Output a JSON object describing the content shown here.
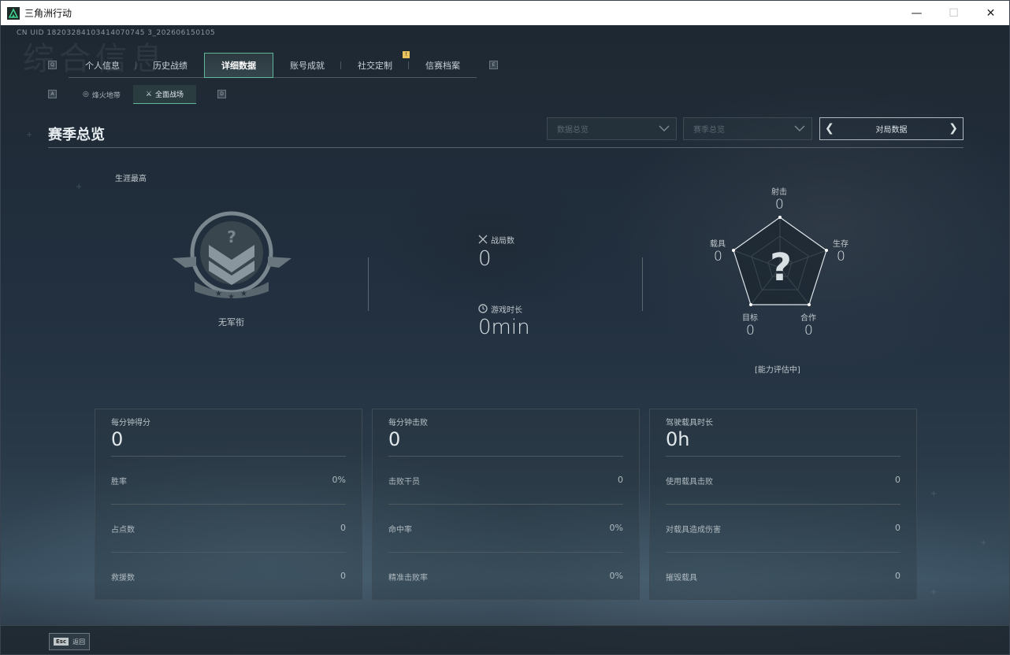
{
  "window": {
    "title": "三角洲行动",
    "minimize": "—",
    "maximize": "☐",
    "close": "✕"
  },
  "uid": "CN UID 18203284103414070745 3_202606150105",
  "bg_title": "综合信息",
  "key_hints": {
    "prev_tab": "Q",
    "next_tab": "E",
    "prev_sub": "A",
    "next_sub": "D"
  },
  "tabs": [
    {
      "label": "个人信息"
    },
    {
      "label": "历史战绩"
    },
    {
      "label": "详细数据",
      "active": true
    },
    {
      "label": "账号成就"
    },
    {
      "label": "社交定制"
    },
    {
      "label": "信赛档案"
    }
  ],
  "tab_badge": "!",
  "subtabs": [
    {
      "label": "烽火地带",
      "icon": "hazard-zone-icon"
    },
    {
      "label": "全面战场",
      "icon": "battlefield-icon",
      "active": true
    }
  ],
  "section_title": "赛季总览",
  "filters": {
    "data_overview": "数据总览",
    "season_overview": "赛季总览",
    "match_data": "对局数据"
  },
  "career": {
    "label": "生涯最高",
    "rank_name": "无军衔"
  },
  "stats": {
    "matches_label": "战局数",
    "matches_value": "0",
    "playtime_label": "游戏时长",
    "playtime_value": "0min"
  },
  "radar": {
    "shooting": {
      "label": "射击",
      "value": "0"
    },
    "survival": {
      "label": "生存",
      "value": "0"
    },
    "cooperation": {
      "label": "合作",
      "value": "0"
    },
    "objective": {
      "label": "目标",
      "value": "0"
    },
    "vehicle": {
      "label": "载具",
      "value": "0"
    },
    "status": "[能力评估中]"
  },
  "cards": [
    {
      "head": "每分钟得分",
      "big": "0",
      "rows": [
        {
          "label": "胜率",
          "value": "0%"
        },
        {
          "label": "占点数",
          "value": "0"
        },
        {
          "label": "救援数",
          "value": "0"
        }
      ]
    },
    {
      "head": "每分钟击败",
      "big": "0",
      "rows": [
        {
          "label": "击败干员",
          "value": "0"
        },
        {
          "label": "命中率",
          "value": "0%"
        },
        {
          "label": "精准击败率",
          "value": "0%"
        }
      ]
    },
    {
      "head": "驾驶载具时长",
      "big": "0h",
      "rows": [
        {
          "label": "使用载具击败",
          "value": "0"
        },
        {
          "label": "对载具造成伤害",
          "value": "0"
        },
        {
          "label": "摧毁载具",
          "value": "0"
        }
      ]
    }
  ],
  "footer": {
    "esc_key": "Esc",
    "back_label": "返回"
  },
  "colors": {
    "accent": "#5fb89a",
    "badge": "#e8c25a"
  }
}
